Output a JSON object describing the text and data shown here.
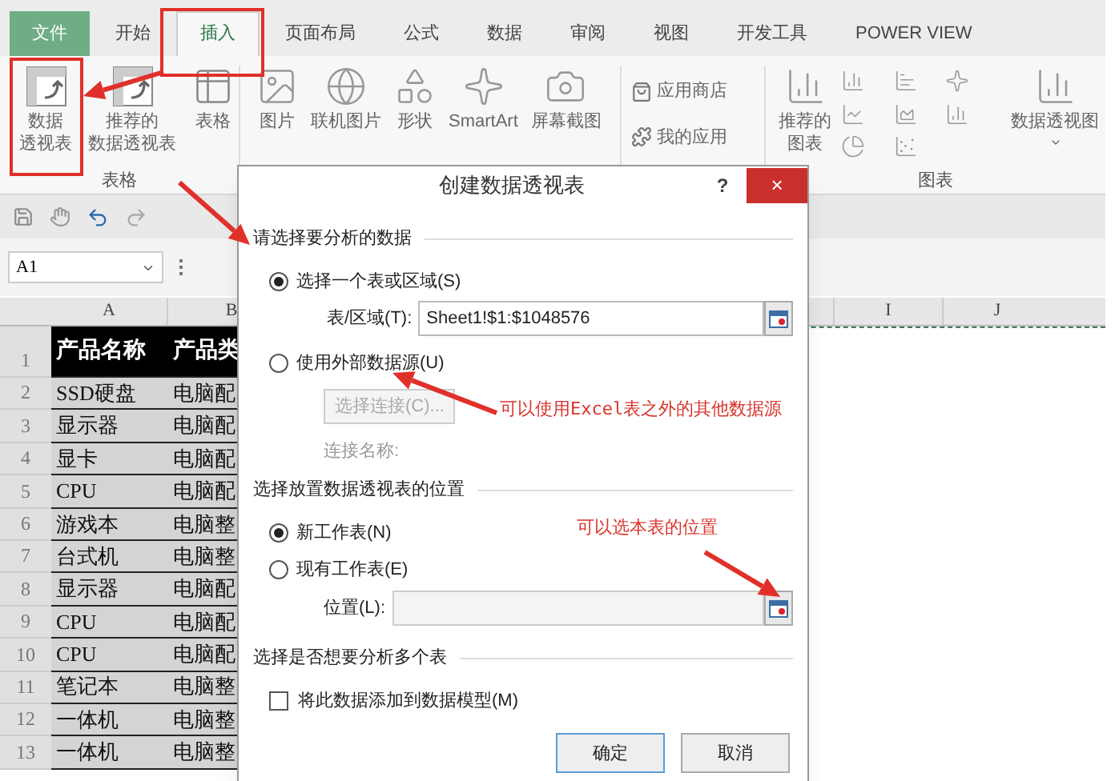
{
  "tabs": [
    {
      "label": "文件",
      "kind": "file",
      "selected": false
    },
    {
      "label": "开始",
      "kind": "tab",
      "selected": false
    },
    {
      "label": "插入",
      "kind": "tab",
      "selected": true
    },
    {
      "label": "页面布局",
      "kind": "tab",
      "selected": false
    },
    {
      "label": "公式",
      "kind": "tab",
      "selected": false
    },
    {
      "label": "数据",
      "kind": "tab",
      "selected": false
    },
    {
      "label": "审阅",
      "kind": "tab",
      "selected": false
    },
    {
      "label": "视图",
      "kind": "tab",
      "selected": false
    },
    {
      "label": "开发工具",
      "kind": "tab",
      "selected": false
    },
    {
      "label": "POWER VIEW",
      "kind": "tab",
      "selected": false
    }
  ],
  "ribbon": {
    "table_group": {
      "label": "表格",
      "buttons": [
        {
          "lines": [
            "数据",
            "透视表"
          ]
        },
        {
          "lines": [
            "推荐的",
            "数据透视表"
          ]
        },
        {
          "lines": [
            "表格"
          ]
        }
      ]
    },
    "illustrations": [
      {
        "lines": [
          "图片"
        ]
      },
      {
        "lines": [
          "联机图片"
        ]
      },
      {
        "lines": [
          "形状"
        ]
      },
      {
        "lines": [
          "SmartArt"
        ]
      },
      {
        "lines": [
          "屏幕截图"
        ]
      }
    ],
    "apps": [
      {
        "label": "应用商店"
      },
      {
        "label": "我的应用"
      }
    ],
    "charts_group": {
      "label": "图表",
      "recommended": {
        "lines": [
          "推荐的",
          "图表"
        ]
      },
      "pivot_chart": {
        "lines": [
          "数据透视图"
        ]
      }
    }
  },
  "name_box": "A1",
  "columns": [
    "A",
    "B"
  ],
  "right_columns": [
    "I",
    "J"
  ],
  "rows": [
    {
      "num": "1",
      "cells": [
        "产品名称",
        "产品类"
      ]
    },
    {
      "num": "2",
      "cells": [
        "SSD硬盘",
        "电脑配"
      ]
    },
    {
      "num": "3",
      "cells": [
        "显示器",
        "电脑配"
      ]
    },
    {
      "num": "4",
      "cells": [
        "显卡",
        "电脑配"
      ]
    },
    {
      "num": "5",
      "cells": [
        "CPU",
        "电脑配"
      ]
    },
    {
      "num": "6",
      "cells": [
        "游戏本",
        "电脑整"
      ]
    },
    {
      "num": "7",
      "cells": [
        "台式机",
        "电脑整"
      ]
    },
    {
      "num": "8",
      "cells": [
        "显示器",
        "电脑配"
      ]
    },
    {
      "num": "9",
      "cells": [
        "CPU",
        "电脑配"
      ]
    },
    {
      "num": "10",
      "cells": [
        "CPU",
        "电脑配"
      ]
    },
    {
      "num": "11",
      "cells": [
        "笔记本",
        "电脑整"
      ]
    },
    {
      "num": "12",
      "cells": [
        "一体机",
        "电脑整"
      ]
    },
    {
      "num": "13",
      "cells": [
        "一体机",
        "电脑整"
      ]
    }
  ],
  "dialog": {
    "title": "创建数据透视表",
    "help": "?",
    "close": "×",
    "section_data": "请选择要分析的数据",
    "source_options": [
      {
        "label": "选择一个表或区域(S)",
        "selected": true
      },
      {
        "label": "使用外部数据源(U)",
        "selected": false
      }
    ],
    "range_label": "表/区域(T):",
    "range_value": "Sheet1!$1:$1048576",
    "connection_button": {
      "label": "选择连接(C)...",
      "disabled": true
    },
    "connection_name_label": "连接名称:",
    "section_place": "选择放置数据透视表的位置",
    "place_options": [
      {
        "label": "新工作表(N)",
        "selected": true
      },
      {
        "label": "现有工作表(E)",
        "selected": false
      }
    ],
    "location_label": "位置(L):",
    "section_multi": "选择是否想要分析多个表",
    "data_model": {
      "label": "将此数据添加到数据模型(M)",
      "checked": false
    },
    "buttons": [
      "确定",
      "取消"
    ]
  },
  "annotations": [
    {
      "text": "可以使用Excel表之外的其他数据源"
    },
    {
      "text": "可以选本表的位置"
    }
  ]
}
